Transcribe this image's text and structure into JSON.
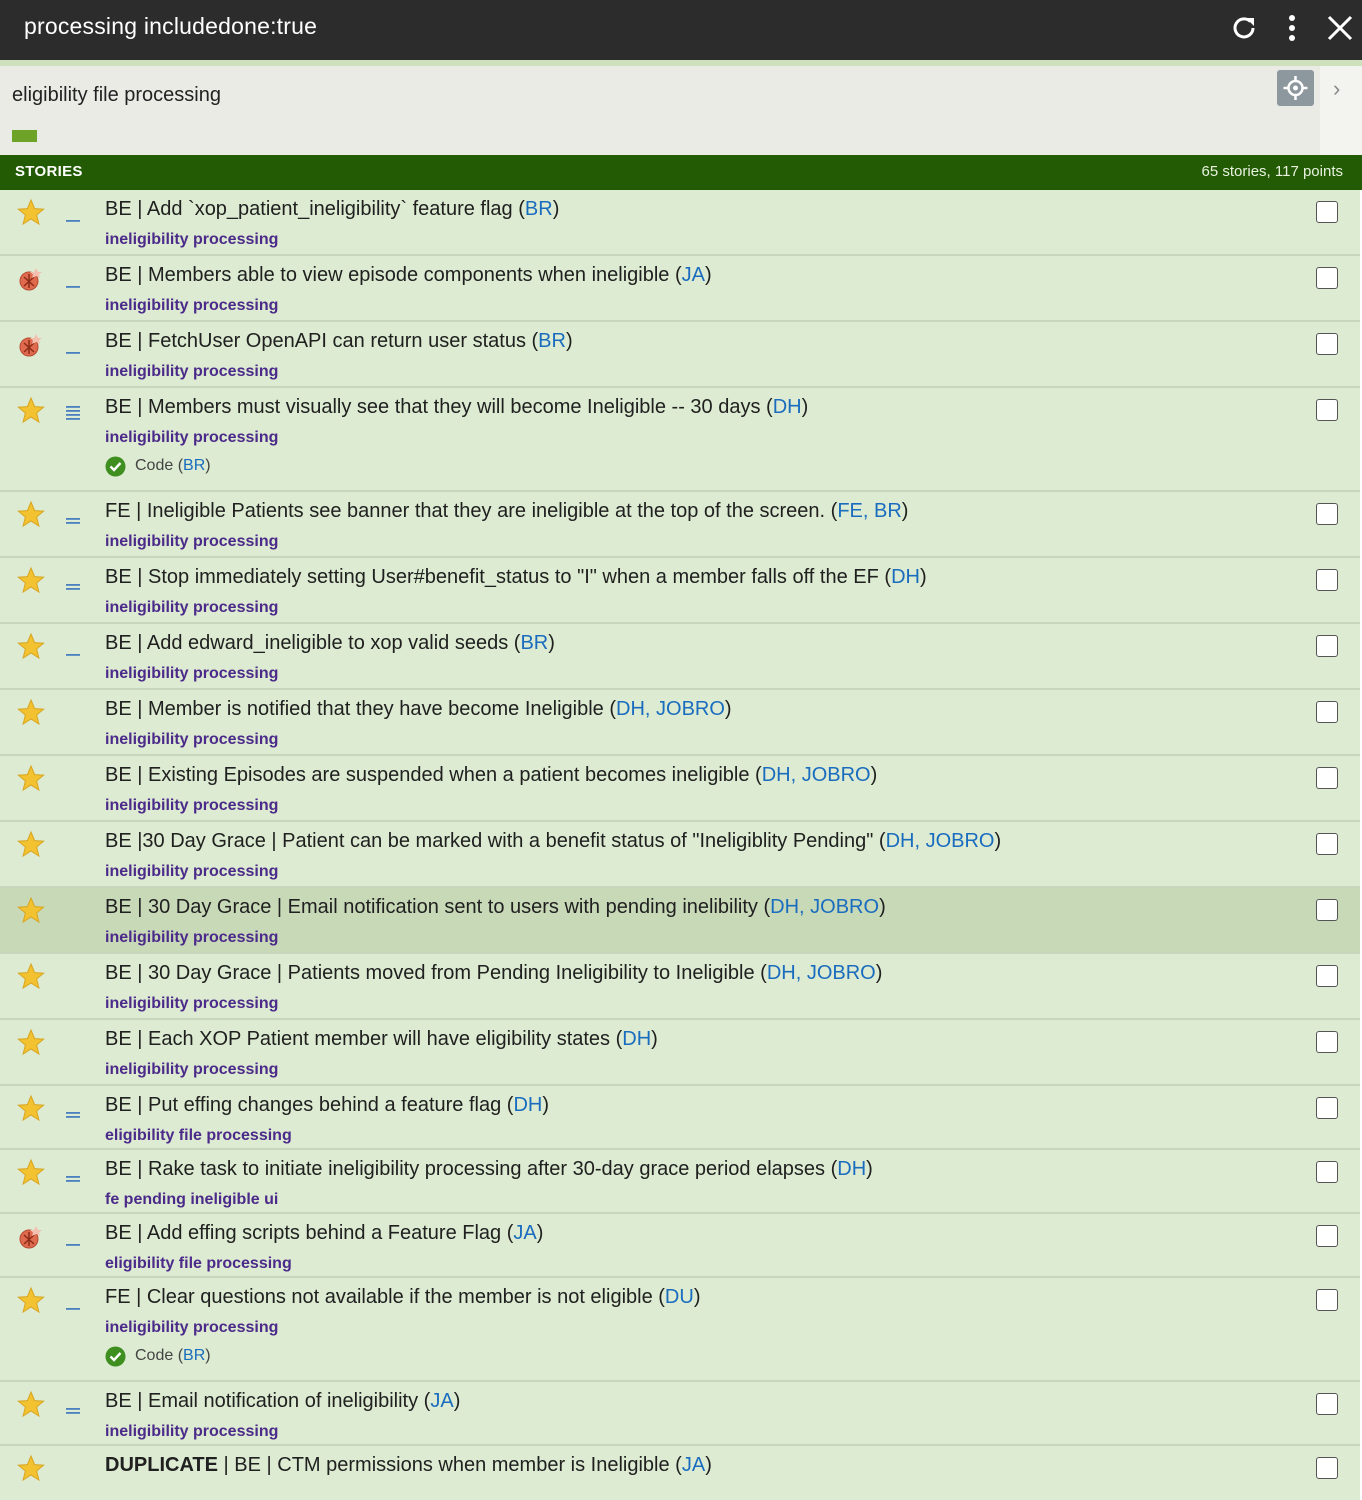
{
  "window": {
    "title": "processing includedone:true"
  },
  "epic": {
    "title": "eligibility file processing",
    "progress": 0.02
  },
  "panel": {
    "header_label": "STORIES",
    "summary": "65 stories, 117 points"
  },
  "stories": [
    {
      "type": "feature",
      "estimate": "1",
      "prefix": "",
      "title": "BE | Add `xop_patient_ineligibility` feature flag (",
      "owners": "BR",
      "close": ")",
      "label": "ineligibility processing"
    },
    {
      "type": "bug",
      "estimate": "1",
      "prefix": "",
      "title": "BE | Members able to view episode components when ineligible (",
      "owners": "JA",
      "close": ")",
      "label": "ineligibility processing"
    },
    {
      "type": "bug",
      "estimate": "1",
      "prefix": "",
      "title": "BE | FetchUser OpenAPI can return user status (",
      "owners": "BR",
      "close": ")",
      "label": "ineligibility processing"
    },
    {
      "type": "feature",
      "estimate": "5",
      "prefix": "",
      "title": "BE | Members must visually see that they will become Ineligible -- 30 days (",
      "owners": "DH",
      "close": ")",
      "label": "ineligibility processing",
      "task": {
        "text": "Code (",
        "owner": "BR",
        "close": ")"
      }
    },
    {
      "type": "feature",
      "estimate": "2",
      "prefix": "",
      "title": "FE | Ineligible Patients see banner that they are ineligible at the top of the screen. (",
      "owners": "FE, BR",
      "close": ")",
      "label": "ineligibility processing"
    },
    {
      "type": "feature",
      "estimate": "2",
      "prefix": "",
      "title": "BE | Stop immediately setting User#benefit_status to \"I\" when a member falls off the EF (",
      "owners": "DH",
      "close": ")",
      "label": "ineligibility processing"
    },
    {
      "type": "feature",
      "estimate": "1",
      "prefix": "",
      "title": "BE | Add edward_ineligible to xop valid seeds (",
      "owners": "BR",
      "close": ")",
      "label": "ineligibility processing"
    },
    {
      "type": "feature",
      "estimate": "",
      "prefix": "",
      "title": "BE | Member is notified that they have become Ineligible (",
      "owners": "DH, JOBRO",
      "close": ")",
      "label": "ineligibility processing"
    },
    {
      "type": "feature",
      "estimate": "",
      "prefix": "",
      "title": "BE | Existing Episodes are suspended when a patient becomes ineligible (",
      "owners": "DH, JOBRO",
      "close": ")",
      "label": "ineligibility processing"
    },
    {
      "type": "feature",
      "estimate": "",
      "prefix": "",
      "title": "BE |30 Day Grace | Patient can be marked with a benefit status of \"Ineligiblity Pending\" (",
      "owners": "DH, JOBRO",
      "close": ")",
      "label": "ineligibility processing"
    },
    {
      "type": "feature",
      "estimate": "",
      "prefix": "",
      "title": "BE | 30 Day Grace | Email notification sent to users with pending inelibility (",
      "owners": "DH, JOBRO",
      "close": ")",
      "label": "ineligibility processing",
      "highlight": true
    },
    {
      "type": "feature",
      "estimate": "",
      "prefix": "",
      "title": "BE | 30 Day Grace | Patients moved from Pending Ineligibility to Ineligible (",
      "owners": "DH, JOBRO",
      "close": ")",
      "label": "ineligibility processing"
    },
    {
      "type": "feature",
      "estimate": "",
      "prefix": "",
      "title": "BE | Each XOP Patient member will have eligibility states (",
      "owners": "DH",
      "close": ")",
      "label": "ineligibility processing"
    },
    {
      "type": "feature",
      "estimate": "2",
      "prefix": "",
      "title": "BE | Put effing changes behind a feature flag (",
      "owners": "DH",
      "close": ")",
      "label": "eligibility file processing"
    },
    {
      "type": "feature",
      "estimate": "3",
      "prefix": "",
      "title": "BE | Rake task to initiate ineligibility processing after 30-day grace period elapses (",
      "owners": "DH",
      "close": ")",
      "label": "fe pending ineligible ui"
    },
    {
      "type": "bug",
      "estimate": "1",
      "prefix": "",
      "title": "BE | Add effing scripts behind a Feature Flag (",
      "owners": "JA",
      "close": ")",
      "label": "eligibility file processing"
    },
    {
      "type": "feature",
      "estimate": "1",
      "prefix": "",
      "title": "FE | Clear questions not available if the member is not eligible (",
      "owners": "DU",
      "close": ")",
      "label": "ineligibility processing",
      "task": {
        "text": "Code (",
        "owner": "BR",
        "close": ")"
      }
    },
    {
      "type": "feature",
      "estimate": "2",
      "prefix": "",
      "title": "BE | Email notification of ineligibility (",
      "owners": "JA",
      "close": ")",
      "label": "ineligibility processing"
    },
    {
      "type": "feature",
      "estimate": "",
      "prefix": "DUPLICATE",
      "title": " | BE | CTM permissions when member is Ineligible (",
      "owners": "JA",
      "close": ")",
      "label": ""
    }
  ]
}
